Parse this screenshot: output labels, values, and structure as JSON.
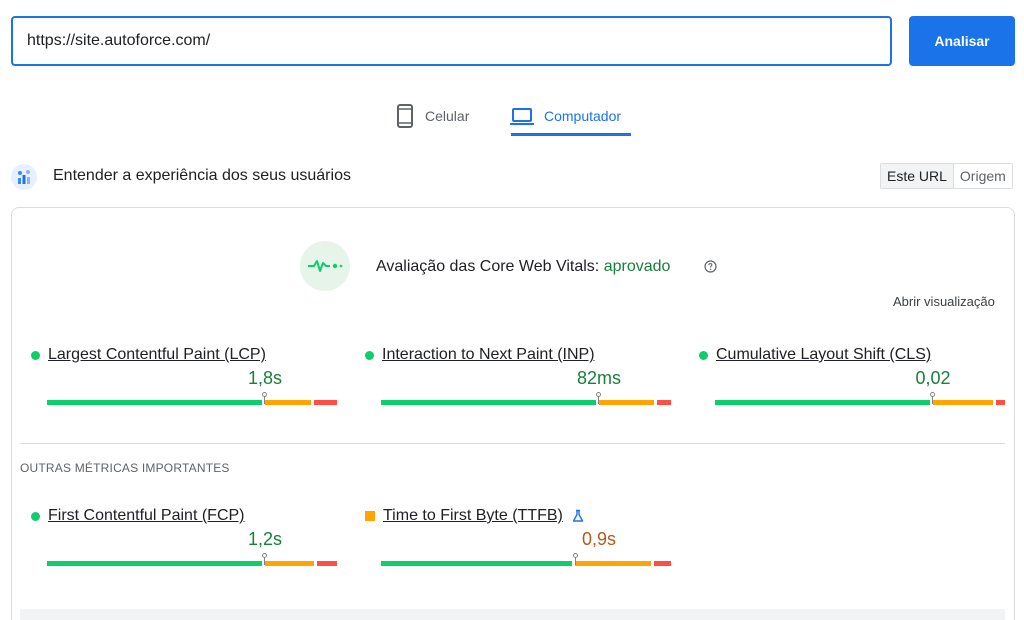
{
  "url_bar": {
    "value": "https://site.autoforce.com/",
    "analyze_label": "Analisar"
  },
  "tabs": {
    "mobile_label": "Celular",
    "desktop_label": "Computador",
    "selected": "desktop"
  },
  "section": {
    "title": "Entender a experiência dos seus usuários",
    "toggle_this_url": "Este URL",
    "toggle_origin": "Origem"
  },
  "assessment": {
    "prefix": "Avaliação das Core Web Vitals: ",
    "status": "aprovado",
    "expand_label": "Abrir visualização"
  },
  "core_metrics": [
    {
      "label": "Largest Contentful Paint (LCP)",
      "value": "1,8s",
      "status": "good"
    },
    {
      "label": "Interaction to Next Paint (INP)",
      "value": "82ms",
      "status": "good"
    },
    {
      "label": "Cumulative Layout Shift (CLS)",
      "value": "0,02",
      "status": "good"
    }
  ],
  "other_metrics": {
    "title": "OUTRAS MÉTRICAS IMPORTANTES",
    "items": [
      {
        "label": "First Contentful Paint (FCP)",
        "value": "1,2s",
        "status": "good"
      },
      {
        "label": "Time to First Byte (TTFB)",
        "value": "0,9s",
        "status": "needs-improvement",
        "experimental": true
      }
    ]
  },
  "distributions": {
    "lcp": {
      "good": 0.75,
      "needs_improvement": 0.17,
      "poor": 0.08
    },
    "inp": {
      "good": 0.75,
      "needs_improvement": 0.2,
      "poor": 0.05
    },
    "cls": {
      "good": 0.75,
      "needs_improvement": 0.22,
      "poor": 0.03
    },
    "fcp": {
      "good": 0.75,
      "needs_improvement": 0.18,
      "poor": 0.07
    },
    "ttfb": {
      "good": 0.67,
      "needs_improvement": 0.27,
      "poor": 0.06
    }
  },
  "colors": {
    "accent": "#1a73e8",
    "good": "#0cce6b",
    "needs_improvement": "#ffa400",
    "poor": "#ff4e42",
    "good_text": "#188038"
  },
  "icons": {
    "mobile_tab": "smartphone-icon",
    "desktop_tab": "laptop-icon",
    "section": "user-experience-icon",
    "assessment": "pulse-icon",
    "help": "help-circle-icon",
    "ttfb_experimental": "flask-icon"
  }
}
